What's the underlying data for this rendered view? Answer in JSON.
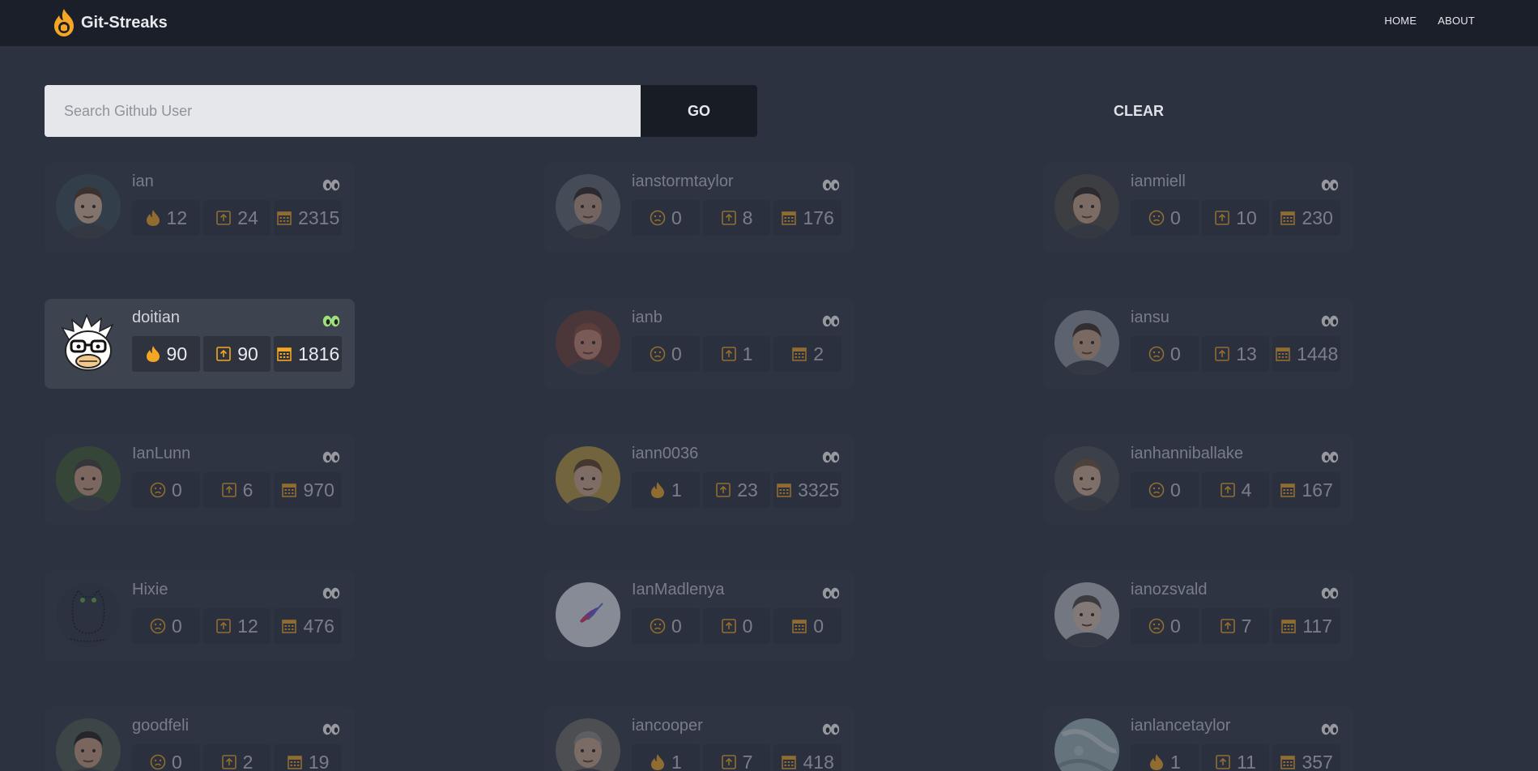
{
  "nav": {
    "brand": "Git-Streaks",
    "links": [
      "HOME",
      "ABOUT"
    ]
  },
  "search": {
    "placeholder": "Search Github User",
    "value": "",
    "go_label": "GO",
    "clear_label": "CLEAR"
  },
  "colors": {
    "accent": "#f5a623",
    "eyes_active": "#9ee07a",
    "navbar": "#1b1f29",
    "background": "#2c3240"
  },
  "stat_icons": [
    "flame-icon",
    "commit-icon",
    "calendar-icon"
  ],
  "users": [
    {
      "name": "ian",
      "streak": "12",
      "streak_icon": "flame",
      "commits": "24",
      "days": "2315",
      "active": false
    },
    {
      "name": "ianstormtaylor",
      "streak": "0",
      "streak_icon": "sad",
      "commits": "8",
      "days": "176",
      "active": false
    },
    {
      "name": "ianmiell",
      "streak": "0",
      "streak_icon": "sad",
      "commits": "10",
      "days": "230",
      "active": false
    },
    {
      "name": "doitian",
      "streak": "90",
      "streak_icon": "flame",
      "commits": "90",
      "days": "1816",
      "active": true
    },
    {
      "name": "ianb",
      "streak": "0",
      "streak_icon": "sad",
      "commits": "1",
      "days": "2",
      "active": false
    },
    {
      "name": "iansu",
      "streak": "0",
      "streak_icon": "sad",
      "commits": "13",
      "days": "1448",
      "active": false
    },
    {
      "name": "IanLunn",
      "streak": "0",
      "streak_icon": "sad",
      "commits": "6",
      "days": "970",
      "active": false
    },
    {
      "name": "iann0036",
      "streak": "1",
      "streak_icon": "flame",
      "commits": "23",
      "days": "3325",
      "active": false
    },
    {
      "name": "ianhanniballake",
      "streak": "0",
      "streak_icon": "sad",
      "commits": "4",
      "days": "167",
      "active": false
    },
    {
      "name": "Hixie",
      "streak": "0",
      "streak_icon": "sad",
      "commits": "12",
      "days": "476",
      "active": false
    },
    {
      "name": "IanMadlenya",
      "streak": "0",
      "streak_icon": "sad",
      "commits": "0",
      "days": "0",
      "active": false
    },
    {
      "name": "ianozsvald",
      "streak": "0",
      "streak_icon": "sad",
      "commits": "7",
      "days": "117",
      "active": false
    },
    {
      "name": "goodfeli",
      "streak": "0",
      "streak_icon": "sad",
      "commits": "2",
      "days": "19",
      "active": false
    },
    {
      "name": "iancooper",
      "streak": "1",
      "streak_icon": "flame",
      "commits": "7",
      "days": "418",
      "active": false
    },
    {
      "name": "ianlancetaylor",
      "streak": "1",
      "streak_icon": "flame",
      "commits": "11",
      "days": "357",
      "active": false
    }
  ]
}
